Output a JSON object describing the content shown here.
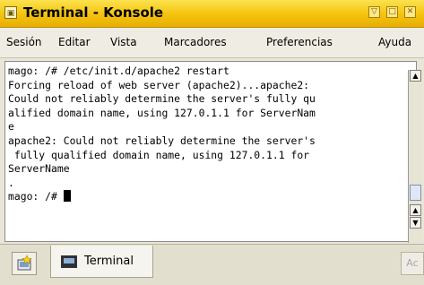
{
  "window": {
    "title": "Terminal - Konsole",
    "buttons": {
      "minimize": "▽",
      "maximize": "□",
      "close": "✕"
    }
  },
  "menubar": {
    "items": [
      "Sesión",
      "Editar",
      "Vista",
      "Marcadores",
      "Preferencias",
      "Ayuda"
    ]
  },
  "terminal": {
    "lines": [
      "mago: /# /etc/init.d/apache2 restart",
      "Forcing reload of web server (apache2)...apache2:",
      "Could not reliably determine the server's fully qu",
      "alified domain name, using 127.0.1.1 for ServerNam",
      "e",
      "apache2: Could not reliably determine the server's",
      " fully qualified domain name, using 127.0.1.1 for",
      "ServerName",
      ".",
      "mago: /# "
    ]
  },
  "tabbar": {
    "tabs": [
      {
        "label": "Terminal"
      }
    ]
  },
  "icons": {
    "app": "konsole-icon",
    "new_tab": "new-session-icon",
    "tab": "terminal-icon",
    "close_tab": "close-tab-icon"
  },
  "colors": {
    "titlebar": "#f4c20c",
    "terminal_bg": "#ffffff",
    "terminal_fg": "#000000",
    "chrome_bg": "#efede3"
  }
}
